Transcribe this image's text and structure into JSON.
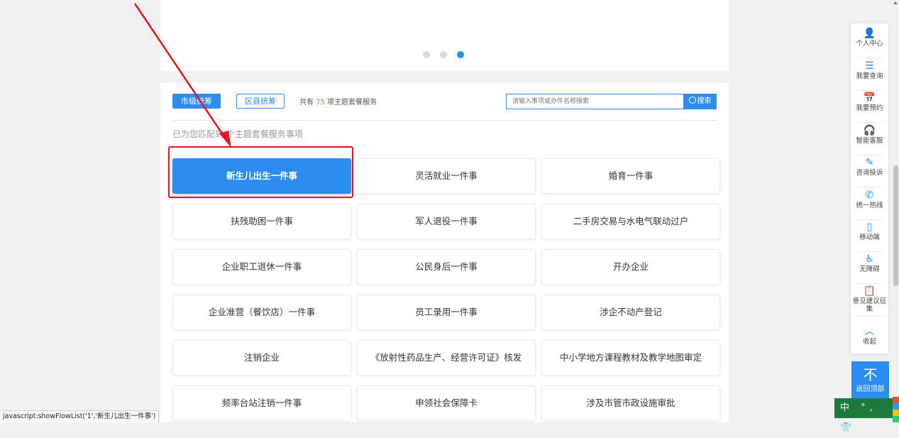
{
  "banner": {
    "dots": 3,
    "active_dot": 3
  },
  "filter": {
    "city_tab": "市级统筹",
    "county_tab": "区县统筹",
    "count_prefix": "共有",
    "count_number": "75",
    "count_suffix": "项主题套餐服务",
    "search_placeholder": "请输入事项或办件名称搜索",
    "search_button": "搜索"
  },
  "match_text": "已为您匹配到 个主题套餐服务事项",
  "services": [
    "新生儿出生一件事",
    "灵活就业一件事",
    "婚育一件事",
    "扶残助困一件事",
    "军人退役一件事",
    "二手房交易与水电气联动过户",
    "企业职工退休一件事",
    "公民身后一件事",
    "开办企业",
    "企业准营（餐饮店）一件事",
    "员工录用一件事",
    "涉企不动产登记",
    "注销企业",
    "《放射性药品生产、经营许可证》核发",
    "中小学地方课程教材及教学地图审定",
    "频率台站注销一件事",
    "申领社会保障卡",
    "涉及市管市政设施审批"
  ],
  "active_service_index": 0,
  "sidebar": [
    {
      "icon": "user-icon",
      "glyph": "👤",
      "label": "个人中心"
    },
    {
      "icon": "query-icon",
      "glyph": "☰",
      "label": "我要查询"
    },
    {
      "icon": "calendar-icon",
      "glyph": "📅",
      "label": "我要预约"
    },
    {
      "icon": "headset-icon",
      "glyph": "🎧",
      "label": "智能客服"
    },
    {
      "icon": "edit-icon",
      "glyph": "✎",
      "label": "咨询投诉"
    },
    {
      "icon": "phone-icon",
      "glyph": "✆",
      "label": "统一热线"
    },
    {
      "icon": "mobile-icon",
      "glyph": "▯",
      "label": "移动端"
    },
    {
      "icon": "accessibility-icon",
      "glyph": "♿",
      "label": "无障碍"
    },
    {
      "icon": "feedback-icon",
      "glyph": "📋",
      "label": "意见建议征集"
    },
    {
      "icon": "collapse-icon",
      "glyph": "︿",
      "label": "收起"
    }
  ],
  "back_to_top": {
    "glyph": "不",
    "label": "返回顶部"
  },
  "ime": "中 °, 👕",
  "status_bar": "javascript:showFlowList('1','新生儿出生一件事')",
  "colors": {
    "accent": "#2d8cf0",
    "highlight": "#e0161e",
    "count": "#f0833a"
  }
}
